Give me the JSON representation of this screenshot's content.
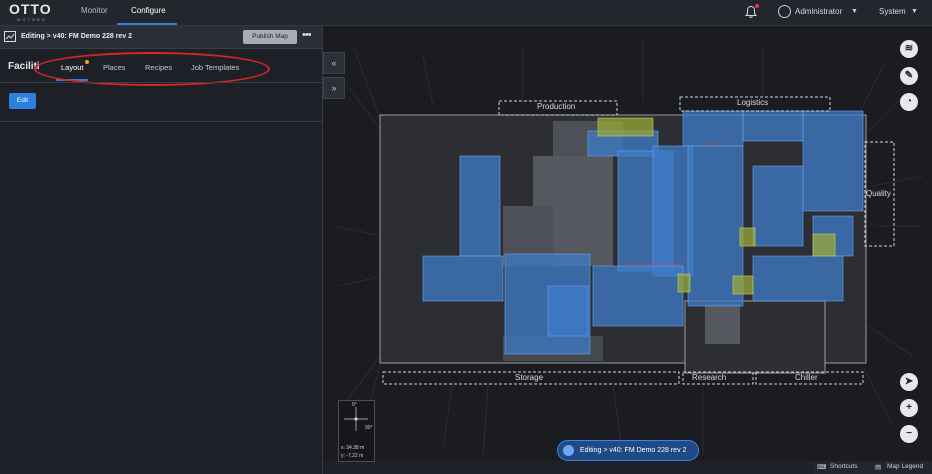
{
  "app": {
    "logo": "OTTO",
    "logo_sub": "MOTORS"
  },
  "topnav": {
    "tabs": [
      {
        "label": "Monitor",
        "active": false
      },
      {
        "label": "Configure",
        "active": true
      }
    ],
    "user": "Administrator",
    "system": "System",
    "notification_dot": true
  },
  "editor": {
    "title": "Editing > v40: FM Demo 228 rev 2",
    "publish_label": "Publish Map",
    "more_label": "•••"
  },
  "panel": {
    "heading": "Faciliti",
    "tabs": [
      {
        "label": "Layout",
        "active": true,
        "badge": true
      },
      {
        "label": "Places",
        "active": false
      },
      {
        "label": "Recipes",
        "active": false
      },
      {
        "label": "Job Templates",
        "active": false
      }
    ],
    "edit_label": "Edit"
  },
  "collapse": {
    "left": "«",
    "right": "»"
  },
  "map": {
    "zones": [
      "Production",
      "Logistics",
      "Quality",
      "Storage",
      "Research",
      "Chiller"
    ],
    "coords": {
      "x": "x: 34.38 m",
      "y": "y: -7.22 m"
    },
    "compass_n": "0°",
    "compass_e": "90°",
    "zoom_in": "+",
    "zoom_out": "−"
  },
  "status": {
    "text": "Editing > v40: FM Demo 228 rev 2"
  },
  "bottombar": {
    "shortcuts": "Shortcuts",
    "legend": "Map Legend"
  },
  "colors": {
    "accent": "#2f7fe0",
    "zone_blue": "#3d7cc9",
    "zone_yellow": "#9aa83a",
    "annotation_red": "#d6261f"
  }
}
